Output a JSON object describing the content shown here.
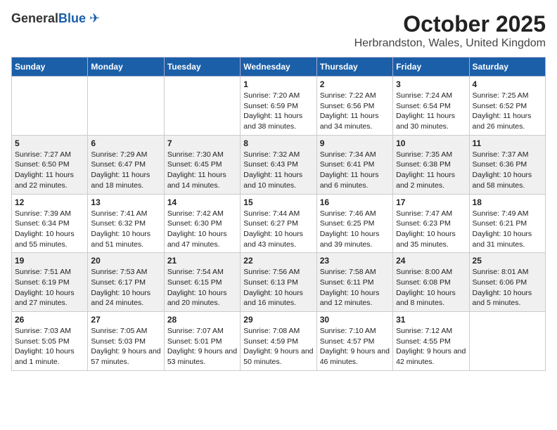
{
  "header": {
    "logo_general": "General",
    "logo_blue": "Blue",
    "title": "October 2025",
    "subtitle": "Herbrandston, Wales, United Kingdom"
  },
  "days": [
    "Sunday",
    "Monday",
    "Tuesday",
    "Wednesday",
    "Thursday",
    "Friday",
    "Saturday"
  ],
  "weeks": [
    [
      {
        "date": "",
        "sunrise": "",
        "sunset": "",
        "daylight": ""
      },
      {
        "date": "",
        "sunrise": "",
        "sunset": "",
        "daylight": ""
      },
      {
        "date": "",
        "sunrise": "",
        "sunset": "",
        "daylight": ""
      },
      {
        "date": "1",
        "sunrise": "Sunrise: 7:20 AM",
        "sunset": "Sunset: 6:59 PM",
        "daylight": "Daylight: 11 hours and 38 minutes."
      },
      {
        "date": "2",
        "sunrise": "Sunrise: 7:22 AM",
        "sunset": "Sunset: 6:56 PM",
        "daylight": "Daylight: 11 hours and 34 minutes."
      },
      {
        "date": "3",
        "sunrise": "Sunrise: 7:24 AM",
        "sunset": "Sunset: 6:54 PM",
        "daylight": "Daylight: 11 hours and 30 minutes."
      },
      {
        "date": "4",
        "sunrise": "Sunrise: 7:25 AM",
        "sunset": "Sunset: 6:52 PM",
        "daylight": "Daylight: 11 hours and 26 minutes."
      }
    ],
    [
      {
        "date": "5",
        "sunrise": "Sunrise: 7:27 AM",
        "sunset": "Sunset: 6:50 PM",
        "daylight": "Daylight: 11 hours and 22 minutes."
      },
      {
        "date": "6",
        "sunrise": "Sunrise: 7:29 AM",
        "sunset": "Sunset: 6:47 PM",
        "daylight": "Daylight: 11 hours and 18 minutes."
      },
      {
        "date": "7",
        "sunrise": "Sunrise: 7:30 AM",
        "sunset": "Sunset: 6:45 PM",
        "daylight": "Daylight: 11 hours and 14 minutes."
      },
      {
        "date": "8",
        "sunrise": "Sunrise: 7:32 AM",
        "sunset": "Sunset: 6:43 PM",
        "daylight": "Daylight: 11 hours and 10 minutes."
      },
      {
        "date": "9",
        "sunrise": "Sunrise: 7:34 AM",
        "sunset": "Sunset: 6:41 PM",
        "daylight": "Daylight: 11 hours and 6 minutes."
      },
      {
        "date": "10",
        "sunrise": "Sunrise: 7:35 AM",
        "sunset": "Sunset: 6:38 PM",
        "daylight": "Daylight: 11 hours and 2 minutes."
      },
      {
        "date": "11",
        "sunrise": "Sunrise: 7:37 AM",
        "sunset": "Sunset: 6:36 PM",
        "daylight": "Daylight: 10 hours and 58 minutes."
      }
    ],
    [
      {
        "date": "12",
        "sunrise": "Sunrise: 7:39 AM",
        "sunset": "Sunset: 6:34 PM",
        "daylight": "Daylight: 10 hours and 55 minutes."
      },
      {
        "date": "13",
        "sunrise": "Sunrise: 7:41 AM",
        "sunset": "Sunset: 6:32 PM",
        "daylight": "Daylight: 10 hours and 51 minutes."
      },
      {
        "date": "14",
        "sunrise": "Sunrise: 7:42 AM",
        "sunset": "Sunset: 6:30 PM",
        "daylight": "Daylight: 10 hours and 47 minutes."
      },
      {
        "date": "15",
        "sunrise": "Sunrise: 7:44 AM",
        "sunset": "Sunset: 6:27 PM",
        "daylight": "Daylight: 10 hours and 43 minutes."
      },
      {
        "date": "16",
        "sunrise": "Sunrise: 7:46 AM",
        "sunset": "Sunset: 6:25 PM",
        "daylight": "Daylight: 10 hours and 39 minutes."
      },
      {
        "date": "17",
        "sunrise": "Sunrise: 7:47 AM",
        "sunset": "Sunset: 6:23 PM",
        "daylight": "Daylight: 10 hours and 35 minutes."
      },
      {
        "date": "18",
        "sunrise": "Sunrise: 7:49 AM",
        "sunset": "Sunset: 6:21 PM",
        "daylight": "Daylight: 10 hours and 31 minutes."
      }
    ],
    [
      {
        "date": "19",
        "sunrise": "Sunrise: 7:51 AM",
        "sunset": "Sunset: 6:19 PM",
        "daylight": "Daylight: 10 hours and 27 minutes."
      },
      {
        "date": "20",
        "sunrise": "Sunrise: 7:53 AM",
        "sunset": "Sunset: 6:17 PM",
        "daylight": "Daylight: 10 hours and 24 minutes."
      },
      {
        "date": "21",
        "sunrise": "Sunrise: 7:54 AM",
        "sunset": "Sunset: 6:15 PM",
        "daylight": "Daylight: 10 hours and 20 minutes."
      },
      {
        "date": "22",
        "sunrise": "Sunrise: 7:56 AM",
        "sunset": "Sunset: 6:13 PM",
        "daylight": "Daylight: 10 hours and 16 minutes."
      },
      {
        "date": "23",
        "sunrise": "Sunrise: 7:58 AM",
        "sunset": "Sunset: 6:11 PM",
        "daylight": "Daylight: 10 hours and 12 minutes."
      },
      {
        "date": "24",
        "sunrise": "Sunrise: 8:00 AM",
        "sunset": "Sunset: 6:08 PM",
        "daylight": "Daylight: 10 hours and 8 minutes."
      },
      {
        "date": "25",
        "sunrise": "Sunrise: 8:01 AM",
        "sunset": "Sunset: 6:06 PM",
        "daylight": "Daylight: 10 hours and 5 minutes."
      }
    ],
    [
      {
        "date": "26",
        "sunrise": "Sunrise: 7:03 AM",
        "sunset": "Sunset: 5:05 PM",
        "daylight": "Daylight: 10 hours and 1 minute."
      },
      {
        "date": "27",
        "sunrise": "Sunrise: 7:05 AM",
        "sunset": "Sunset: 5:03 PM",
        "daylight": "Daylight: 9 hours and 57 minutes."
      },
      {
        "date": "28",
        "sunrise": "Sunrise: 7:07 AM",
        "sunset": "Sunset: 5:01 PM",
        "daylight": "Daylight: 9 hours and 53 minutes."
      },
      {
        "date": "29",
        "sunrise": "Sunrise: 7:08 AM",
        "sunset": "Sunset: 4:59 PM",
        "daylight": "Daylight: 9 hours and 50 minutes."
      },
      {
        "date": "30",
        "sunrise": "Sunrise: 7:10 AM",
        "sunset": "Sunset: 4:57 PM",
        "daylight": "Daylight: 9 hours and 46 minutes."
      },
      {
        "date": "31",
        "sunrise": "Sunrise: 7:12 AM",
        "sunset": "Sunset: 4:55 PM",
        "daylight": "Daylight: 9 hours and 42 minutes."
      },
      {
        "date": "",
        "sunrise": "",
        "sunset": "",
        "daylight": ""
      }
    ]
  ]
}
